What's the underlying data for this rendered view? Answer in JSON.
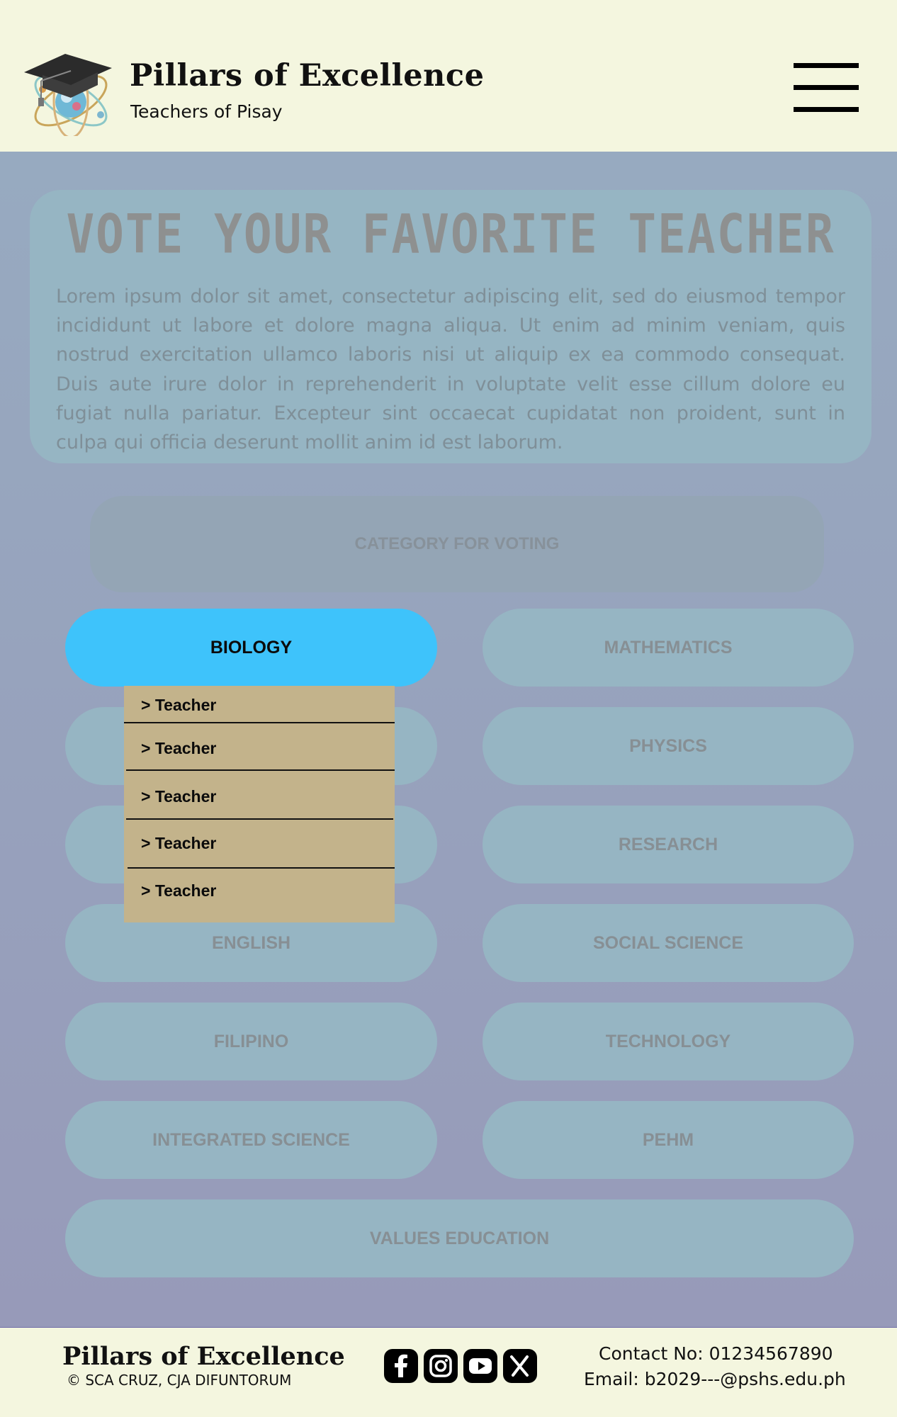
{
  "header": {
    "title": "Pillars of Excellence",
    "subtitle": "Teachers of Pisay",
    "logo_icon": "graduation-cap-atom-icon",
    "menu_icon": "hamburger-menu-icon"
  },
  "intro": {
    "title": "VOTE YOUR FAVORITE TEACHER",
    "text": "Lorem ipsum dolor sit amet, consectetur adipiscing elit, sed do eiusmod tempor incididunt ut labore et dolore magna aliqua. Ut enim ad minim veniam, quis nostrud exercitation ullamco laboris nisi ut aliquip ex ea commodo consequat. Duis aute irure dolor in reprehenderit in voluptate velit esse cillum dolore eu fugiat nulla pariatur. Excepteur sint occaecat cupidatat non proident, sunt in culpa qui officia deserunt mollit anim id est laborum."
  },
  "category_label": "CATEGORY FOR VOTING",
  "subjects": {
    "biology": "BIOLOGY",
    "mathematics": "MATHEMATICS",
    "physics": "PHYSICS",
    "research": "RESEARCH",
    "english": "ENGLISH",
    "social_science": "SOCIAL SCIENCE",
    "filipino": "FILIPINO",
    "technology": "TECHNOLOGY",
    "integrated_science": "INTEGRATED SCIENCE",
    "pehm": "PEHM",
    "values_education": "VALUES EDUCATION",
    "active": "BIOLOGY"
  },
  "dropdown": {
    "items": [
      "> Teacher",
      "> Teacher",
      "> Teacher",
      "> Teacher",
      "> Teacher"
    ]
  },
  "footer": {
    "title": "Pillars of Excellence",
    "copyright": "© SCA CRUZ, CJA DIFUNTORUM",
    "social_icons": [
      "facebook-icon",
      "instagram-icon",
      "youtube-icon",
      "x-icon"
    ],
    "contact": "Contact No: 01234567890",
    "email": "Email: b2029---@pshs.edu.ph"
  },
  "colors": {
    "header_bg": "#f4f6df",
    "active_button": "#3ec3fb",
    "button_bg": "#96b5c3",
    "dropdown_bg": "#c3b38b"
  }
}
